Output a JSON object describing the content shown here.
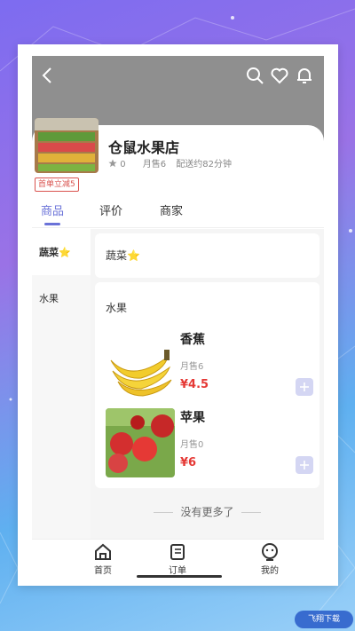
{
  "shop": {
    "name": "仓鼠水果店",
    "rating": "0",
    "monthly_sales": "月售6",
    "delivery": "配送约82分钟",
    "promo": "首单立减5"
  },
  "tabs": [
    {
      "label": "商品"
    },
    {
      "label": "评价"
    },
    {
      "label": "商家"
    }
  ],
  "sidebar": {
    "items": [
      {
        "label": "蔬菜⭐"
      },
      {
        "label": "水果"
      }
    ]
  },
  "sections": [
    {
      "title": "蔬菜⭐"
    },
    {
      "title": "水果"
    }
  ],
  "products": [
    {
      "name": "香蕉",
      "sales": "月售6",
      "price": "¥4.5"
    },
    {
      "name": "苹果",
      "sales": "月售0",
      "price": "¥6"
    }
  ],
  "list_end": "没有更多了",
  "bottom_nav": [
    {
      "label": "首页"
    },
    {
      "label": "订单"
    },
    {
      "label": "我的"
    }
  ],
  "icons": {
    "back": "back-arrow-icon",
    "search": "search-icon",
    "favorite": "heart-icon",
    "notify": "bell-icon",
    "star": "star-icon",
    "add": "plus-icon",
    "home": "home-icon",
    "orders": "order-list-icon",
    "profile": "profile-icon"
  },
  "colors": {
    "accent": "#6a72d8",
    "price": "#e53935",
    "header": "#8f8f8f",
    "promo": "#d9534f"
  },
  "watermark": "飞翔下载"
}
